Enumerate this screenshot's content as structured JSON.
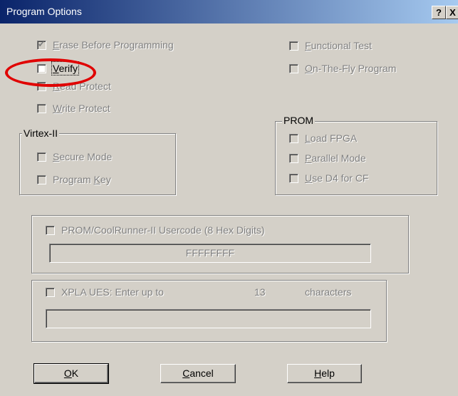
{
  "window": {
    "title": "Program Options",
    "help_button": "?",
    "close_button": "X"
  },
  "options_left": [
    {
      "label_access": "E",
      "label_rest": "rase Before Programming",
      "checked": true,
      "enabled": false
    },
    {
      "label_access": "V",
      "label_rest": "erify",
      "checked": false,
      "enabled": true
    },
    {
      "label_access": "R",
      "label_rest": "ead Protect",
      "checked": false,
      "enabled": false
    },
    {
      "label_access": "W",
      "label_rest": "rite Protect",
      "checked": false,
      "enabled": false
    }
  ],
  "options_right": [
    {
      "label_access": "F",
      "label_rest": "unctional Test",
      "checked": false,
      "enabled": false
    },
    {
      "label_access": "O",
      "label_rest": "n-The-Fly Program",
      "checked": false,
      "enabled": false
    }
  ],
  "virtex_group": {
    "title": "Virtex-II",
    "items": [
      {
        "label_access": "S",
        "label_rest": "ecure Mode",
        "checked": false,
        "enabled": false
      },
      {
        "label_pre": "Program ",
        "label_access": "K",
        "label_rest": "ey",
        "checked": false,
        "enabled": false
      }
    ]
  },
  "prom_group": {
    "title": "PROM",
    "items": [
      {
        "label_access": "L",
        "label_rest": "oad FPGA",
        "checked": false,
        "enabled": false
      },
      {
        "label_access": "P",
        "label_rest": "arallel Mode",
        "checked": false,
        "enabled": false
      },
      {
        "label_access": "U",
        "label_rest": "se D4 for CF",
        "checked": false,
        "enabled": false
      }
    ]
  },
  "usercode": {
    "label": "PROM/CoolRunner-II Usercode (8 Hex Digits)",
    "value": "FFFFFFFF",
    "checked": false,
    "enabled": false
  },
  "xpla": {
    "label": "XPLA UES: Enter up to",
    "count": "13",
    "suffix": "characters",
    "value": "",
    "checked": false,
    "enabled": false
  },
  "buttons": {
    "ok_access": "O",
    "ok_rest": "K",
    "cancel_access": "C",
    "cancel_rest": "ancel",
    "help_access": "H",
    "help_rest": "elp"
  },
  "annotation": {
    "color": "#e00000",
    "target": "Verify"
  }
}
